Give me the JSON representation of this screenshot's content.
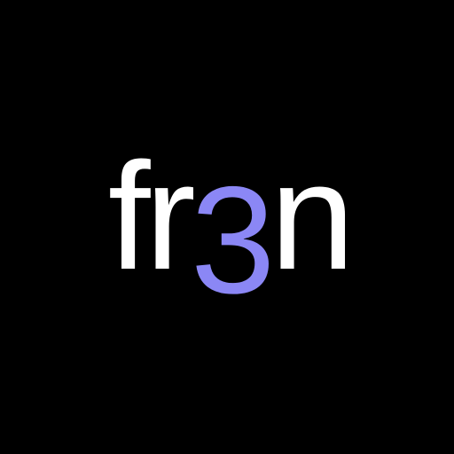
{
  "logo": {
    "text_prefix": "fr",
    "text_accent": "3",
    "text_suffix": "n",
    "colors": {
      "background": "#000000",
      "primary_text": "#FFFFFF",
      "accent_text": "#8B87F5"
    }
  }
}
